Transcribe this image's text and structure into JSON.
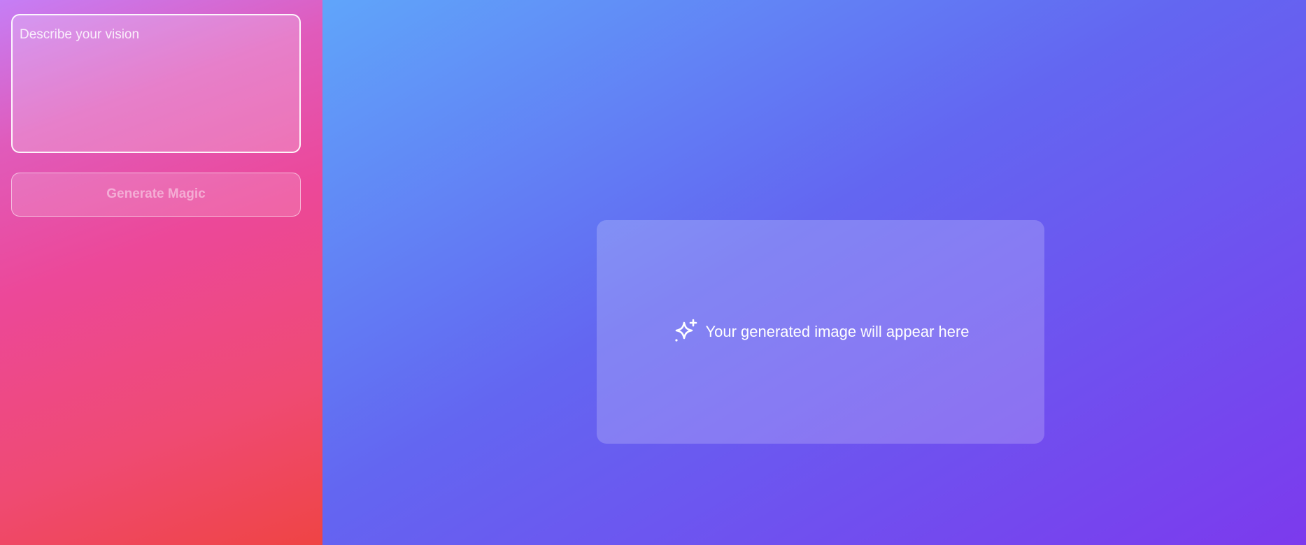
{
  "sidebar": {
    "prompt": {
      "placeholder": "Describe your vision",
      "value": ""
    },
    "generate_button": {
      "label": "Generate Magic",
      "state": "disabled"
    }
  },
  "main": {
    "preview": {
      "icon": "sparkles-icon",
      "message": "Your generated image will appear here"
    }
  },
  "colors": {
    "sidebar_gradient": [
      "#c57ef6",
      "#ec4899",
      "#ef4444"
    ],
    "main_gradient": [
      "#60a5fa",
      "#6366f1",
      "#7c3aed"
    ],
    "text": "#ffffff"
  }
}
